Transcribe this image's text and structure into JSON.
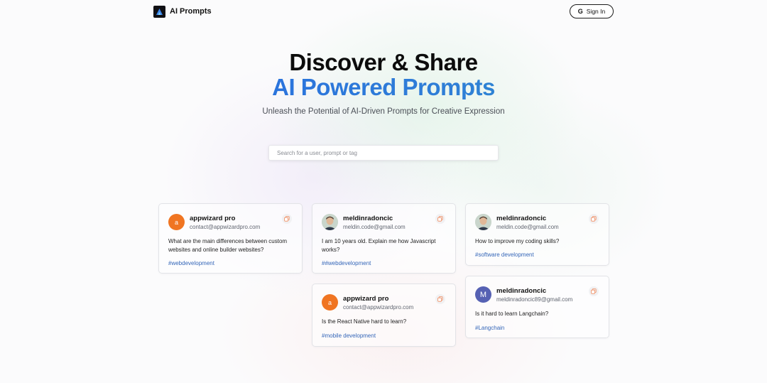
{
  "nav": {
    "brand": "AI Prompts",
    "sign_in_label": "Sign In"
  },
  "hero": {
    "title_line1": "Discover & Share",
    "title_line2": "AI Powered Prompts",
    "subtitle": "Unleash the Potential of AI-Driven Prompts for Creative Expression"
  },
  "search": {
    "placeholder": "Search for a user, prompt or tag",
    "value": ""
  },
  "colors": {
    "accent_blue": "#2463e6",
    "avatar_orange": "#f07522",
    "avatar_indigo": "#5661b3",
    "tag_blue": "#3466b8"
  },
  "cards": [
    {
      "username": "appwizard pro",
      "email": "contact@appwizardpro.com",
      "avatar": "a",
      "prompt": "What are the main differences between custom websites and online builder websites?",
      "tag": "#webdevelopment"
    },
    {
      "username": "meldinradoncic",
      "email": "meldin.code@gmail.com",
      "avatar": "photo",
      "prompt": "I am 10 years old. Explain me how Javascript works?",
      "tag": "##webdevelopment"
    },
    {
      "username": "meldinradoncic",
      "email": "meldin.code@gmail.com",
      "avatar": "photo",
      "prompt": "How to improve my coding skills?",
      "tag": "#software development"
    },
    {
      "username": "appwizard pro",
      "email": "contact@appwizardpro.com",
      "avatar": "a",
      "prompt": "Is the React Native hard to learn?",
      "tag": "#mobile development"
    },
    {
      "username": "meldinradoncic",
      "email": "meldinradoncic89@gmail.com",
      "avatar": "M",
      "prompt": "Is it hard to learn Langchain?",
      "tag": "#Langchain"
    }
  ]
}
